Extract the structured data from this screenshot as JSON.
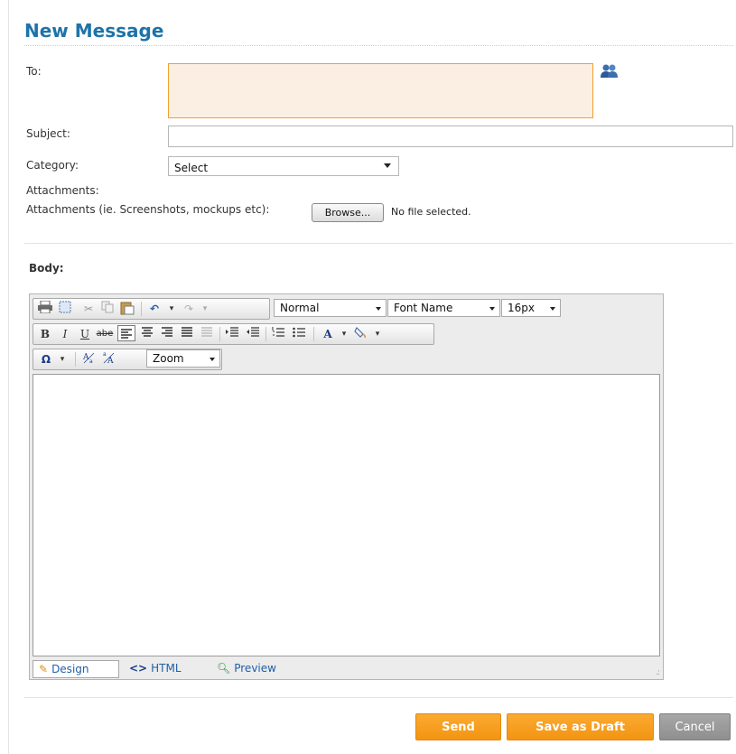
{
  "page": {
    "title": "New Message"
  },
  "form": {
    "to_label": "To:",
    "subject_label": "Subject:",
    "subject_value": "",
    "category_label": "Category:",
    "category_selected": "Select",
    "attachments_label": "Attachments:",
    "attachments_hint": "Attachments (ie. Screenshots, mockups etc):",
    "browse_label": "Browse...",
    "file_status": "No file selected.",
    "body_label": "Body:"
  },
  "editor": {
    "format_dropdown": "Normal",
    "font_dropdown": "Font Name",
    "size_dropdown": "16px",
    "zoom_dropdown": "Zoom",
    "bold": "B",
    "italic": "I",
    "underline": "U",
    "strike": "abe",
    "font_color": "A",
    "special_char": "Ω",
    "modes": {
      "design": "Design",
      "html": "HTML",
      "preview": "Preview"
    },
    "html_glyph": "<>"
  },
  "actions": {
    "send": "Send",
    "save_draft": "Save as Draft",
    "cancel": "Cancel"
  },
  "colors": {
    "title": "#1e73a8",
    "to_bg": "#fbefe4",
    "to_border": "#f0a030",
    "button_orange": "#f7a020",
    "button_grey": "#9a9a9a"
  },
  "icons": {
    "contacts": "contacts-icon",
    "print": "print-icon",
    "select_all": "select-all-icon",
    "cut": "cut-icon",
    "copy": "copy-icon",
    "paste": "paste-icon",
    "undo": "undo-icon",
    "redo": "redo-icon"
  }
}
